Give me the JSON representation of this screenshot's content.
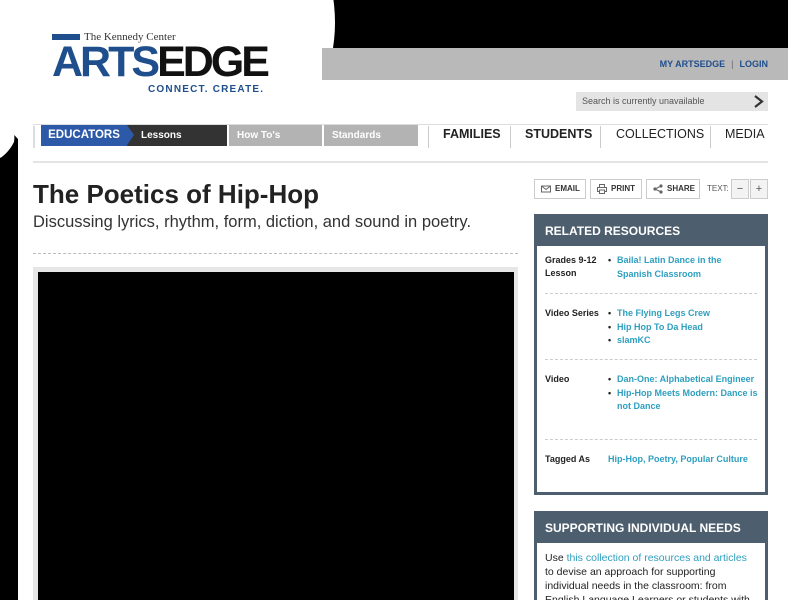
{
  "header": {
    "org": "The Kennedy Center",
    "brand_arts": "ARTS",
    "brand_edge": "EDGE",
    "tagline": "CONNECT. CREATE.",
    "my_artsedge": "MY ARTSEDGE",
    "separator": "|",
    "login": "LOGIN",
    "search_placeholder": "Search is currently unavailable"
  },
  "nav": {
    "educators": "EDUCATORS",
    "sub": [
      "Lessons",
      "How To's",
      "Standards"
    ],
    "main": [
      "FAMILIES",
      "STUDENTS",
      "COLLECTIONS",
      "MEDIA"
    ]
  },
  "article": {
    "title": "The Poetics of Hip-Hop",
    "subtitle": "Discussing lyrics, rhythm, form, diction, and sound in poetry."
  },
  "tools": {
    "email": "EMAIL",
    "print": "PRINT",
    "share": "SHARE",
    "text_label": "TEXT:",
    "minus": "−",
    "plus": "+"
  },
  "related": {
    "heading": "RELATED RESOURCES",
    "groups": [
      {
        "label": "Grades 9-12 Lesson",
        "links": [
          "Baila! Latin Dance in the Spanish Classroom"
        ]
      },
      {
        "label": "Video Series",
        "links": [
          "The Flying Legs Crew",
          "Hip Hop To Da Head",
          "slamKC"
        ]
      },
      {
        "label": "Video",
        "links": [
          "Dan-One: Alphabetical Engineer",
          "Hip-Hop Meets Modern: Dance is not Dance"
        ]
      },
      {
        "label": "Tagged As",
        "links": [
          "Hip-Hop, Poetry, Popular Culture"
        ]
      }
    ]
  },
  "support": {
    "heading": "SUPPORTING INDIVIDUAL NEEDS",
    "text_before": "Use ",
    "link": "this collection of resources and articles",
    "text_after": " to devise an approach for supporting individual needs in the classroom: from English Language Learners or students with"
  },
  "colors": {
    "brand_blue": "#1f4e8c",
    "nav_blue": "#2d5aa8",
    "link_teal": "#2e9fbf",
    "panel_slate": "#4d5e6e"
  },
  "icons": [
    "email-icon",
    "print-icon",
    "share-icon",
    "search-arrow-icon"
  ]
}
